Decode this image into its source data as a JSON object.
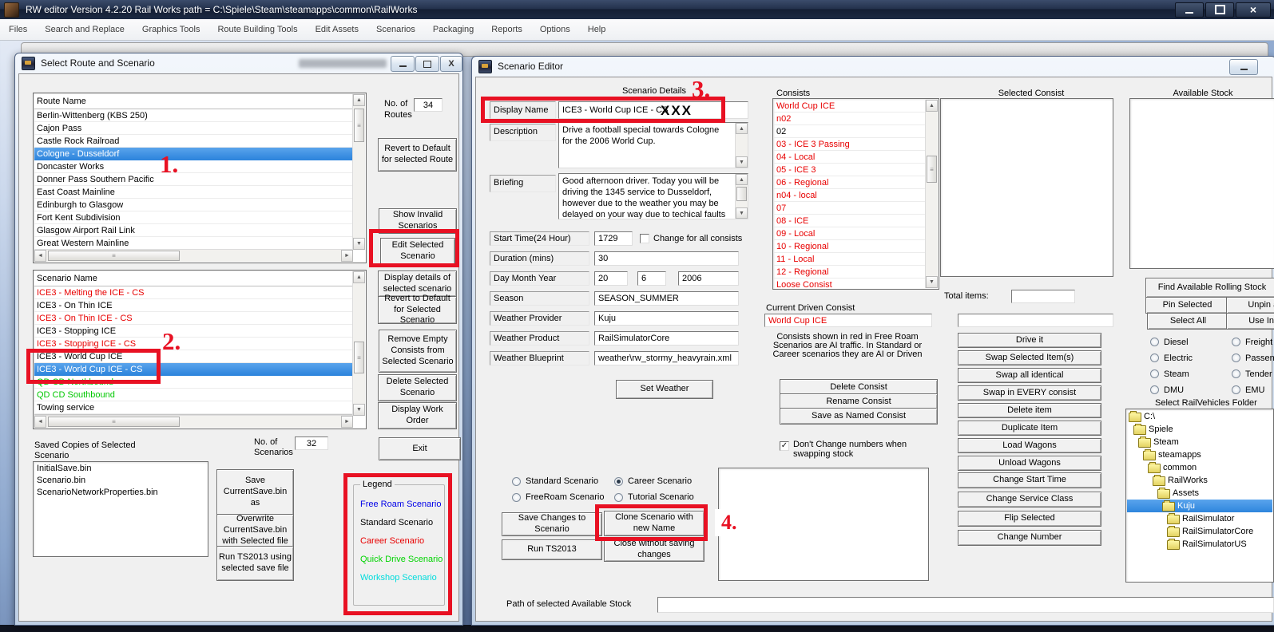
{
  "main": {
    "title": "RW editor  Version 4.2.20   Rail Works path = C:\\Spiele\\Steam\\steamapps\\common\\RailWorks",
    "menu": [
      "Files",
      "Search and Replace",
      "Graphics Tools",
      "Route Building Tools",
      "Edit Assets",
      "Scenarios",
      "Packaging",
      "Reports",
      "Options",
      "Help"
    ],
    "close_glyph": "×"
  },
  "route_window": {
    "title": "Select Route and Scenario",
    "route_header": "Route Name",
    "routes": [
      "Berlin-Wittenberg (KBS 250)",
      "Cajon Pass",
      "Castle Rock Railroad",
      {
        "label": "Cologne - Dusseldorf",
        "selected": true
      },
      "Doncaster Works",
      "Donner Pass Southern Pacific",
      "East Coast Mainline",
      "Edinburgh to Glasgow",
      "Fort Kent Subdivision",
      "Glasgow Airport Rail Link",
      "Great Western Mainline"
    ],
    "no_of_label1": "No. of",
    "no_of_routes_label2": "Routes",
    "no_of_routes_value": "34",
    "btn_revert_route": "Revert to Default for selected Route",
    "btn_show_invalid": "Show Invalid Scenarios",
    "btn_edit_selected": "Edit Selected Scenario",
    "btn_display_details": "Display details of selected scenario",
    "btn_revert_scenario": "Revert to Default for Selected Scenario",
    "btn_remove_empty": "Remove Empty Consists from Selected Scenario",
    "btn_delete_scenario": "Delete Selected Scenario",
    "btn_display_work_order": "Display Work Order",
    "btn_exit": "Exit",
    "scenario_header": "Scenario Name",
    "scenarios": [
      {
        "label": "ICE3 - Melting the ICE - CS",
        "color": "#e80000"
      },
      {
        "label": "ICE3 - On Thin ICE"
      },
      {
        "label": "ICE3 - On Thin ICE - CS",
        "color": "#e80000"
      },
      {
        "label": "ICE3 - Stopping ICE"
      },
      {
        "label": "ICE3 - Stopping ICE - CS",
        "color": "#e80000"
      },
      {
        "label": "ICE3 - World Cup ICE"
      },
      {
        "label": "ICE3 - World Cup ICE - CS",
        "selected": true
      },
      {
        "label": "QD CD Northbound",
        "color": "#00c800"
      },
      {
        "label": "QD CD Southbound",
        "color": "#00c800"
      },
      {
        "label": "Towing service"
      }
    ],
    "no_of_scenarios_label2": "Scenarios",
    "no_of_scenarios_value": "32",
    "saved_copies_label1": "Saved Copies of Selected",
    "saved_copies_label2": "Scenario",
    "saved_files": [
      "InitialSave.bin",
      "Scenario.bin",
      "ScenarioNetworkProperties.bin"
    ],
    "btn_save_current": "Save CurrentSave.bin as",
    "btn_overwrite": "Overwrite CurrentSave.bin with Selected file",
    "btn_run_ts2013_save": "Run TS2013 using selected save file",
    "legend": {
      "title": "Legend",
      "items": [
        {
          "label": "Free Roam Scenario",
          "color": "#0000e8"
        },
        {
          "label": "Standard Scenario",
          "color": "#000000"
        },
        {
          "label": "Career Scenario",
          "color": "#e80000"
        },
        {
          "label": "Quick Drive Scenario",
          "color": "#00d400"
        },
        {
          "label": "Workshop Scenario",
          "color": "#00dcdc"
        }
      ]
    }
  },
  "editor": {
    "title": "Scenario Editor",
    "details_heading": "Scenario Details",
    "display_name_label": "Display Name",
    "display_name": "ICE3 - World Cup ICE - CS",
    "description_label": "Description",
    "description": "Drive a football special towards Cologne for the 2006 World Cup.",
    "briefing_label": "Briefing",
    "briefing": "Good afternoon driver. Today you will be driving the 1345 service to Dusseldorf, however due to the weather you may be delayed on your way due to techical faults with",
    "start_time_label": "Start Time(24 Hour)",
    "start_time": "1729",
    "change_all_label": "Change for all consists",
    "duration_label": "Duration (mins)",
    "duration": "30",
    "dmy_label": "Day Month Year",
    "day": "20",
    "month": "6",
    "year": "2006",
    "season_label": "Season",
    "season": "SEASON_SUMMER",
    "weather_provider_label": "Weather Provider",
    "weather_provider": "Kuju",
    "weather_product_label": "Weather Product",
    "weather_product": "RailSimulatorCore",
    "weather_blueprint_label": "Weather Blueprint",
    "weather_blueprint": "weather\\rw_stormy_heavyrain.xml",
    "btn_set_weather": "Set Weather",
    "radio_standard": "Standard Scenario",
    "radio_freeroam": "FreeRoam Scenario",
    "radio_career": "Career Scenario",
    "radio_tutorial": "Tutorial Scenario",
    "btn_save_changes": "Save Changes to Scenario",
    "btn_clone": "Clone Scenario with new Name",
    "btn_run": "Run TS2013",
    "btn_close": "Close without saving changes",
    "path_label": "Path of selected Available Stock",
    "consists_label": "Consists",
    "consists": [
      {
        "label": "World Cup ICE",
        "color": "#e80000"
      },
      {
        "label": "n02",
        "color": "#e80000"
      },
      {
        "label": "02"
      },
      {
        "label": "03 - ICE 3 Passing",
        "color": "#e80000"
      },
      {
        "label": "04 - Local",
        "color": "#e80000"
      },
      {
        "label": "05 - ICE 3",
        "color": "#e80000"
      },
      {
        "label": "06 - Regional",
        "color": "#e80000"
      },
      {
        "label": "n04 - local",
        "color": "#e80000"
      },
      {
        "label": "07",
        "color": "#e80000"
      },
      {
        "label": "08 - ICE",
        "color": "#e80000"
      },
      {
        "label": "09 - Local",
        "color": "#e80000"
      },
      {
        "label": "10 - Regional",
        "color": "#e80000"
      },
      {
        "label": "11 - Local",
        "color": "#e80000"
      },
      {
        "label": "12 - Regional",
        "color": "#e80000"
      },
      {
        "label": "Loose Consist",
        "color": "#e80000"
      }
    ],
    "total_items_label": "Total items:",
    "current_driven_label": "Current Driven Consist",
    "current_driven": "World Cup ICE",
    "red_note": "Consists shown in red in Free Roam Scenarios are AI traffic. In Standard or Career scenarios they are AI or Driven",
    "btn_delete_consist": "Delete Consist",
    "btn_rename_consist": "Rename Consist",
    "btn_save_named": "Save as Named Consist",
    "dont_change_label1": "Don't Change numbers when",
    "dont_change_label2": "swapping stock",
    "check_glyph": "✓",
    "selected_consist_label": "Selected Consist",
    "stock_buttons": [
      "Drive it",
      "Swap Selected Item(s)",
      "Swap all identical",
      "Swap in EVERY consist",
      "Delete item",
      "Duplicate Item",
      "Load Wagons",
      "Unload Wagons"
    ],
    "change_buttons": [
      "Change Start Time",
      "Change Service Class",
      "Flip Selected",
      "Change Number"
    ],
    "available_stock_label": "Available Stock",
    "btn_find_stock": "Find Available Rolling Stock",
    "btn_pin": "Pin Selected",
    "btn_unpin": "Unpin all it",
    "btn_select_all": "Select All",
    "btn_use_index": "Use Index",
    "engine_radios_left": [
      "Diesel",
      "Electric",
      "Steam",
      "DMU"
    ],
    "engine_radios_right": [
      "Freight",
      "Passen",
      "Tender",
      "EMU"
    ],
    "select_folder_label": "Select RailVehicles Folder",
    "tree": [
      {
        "label": "C:\\",
        "indent": 0
      },
      {
        "label": "Spiele",
        "indent": 1
      },
      {
        "label": "Steam",
        "indent": 2
      },
      {
        "label": "steamapps",
        "indent": 3
      },
      {
        "label": "common",
        "indent": 4
      },
      {
        "label": "RailWorks",
        "indent": 5
      },
      {
        "label": "Assets",
        "indent": 6
      },
      {
        "label": "Kuju",
        "indent": 7,
        "selected": true
      },
      {
        "label": "RailSimulator",
        "indent": 8
      },
      {
        "label": "RailSimulatorCore",
        "indent": 8
      },
      {
        "label": "RailSimulatorUS",
        "indent": 8
      }
    ]
  },
  "annotations": {
    "n1": "1.",
    "n2": "2.",
    "n3": "3.",
    "n4": "4.",
    "xxx": "XXX"
  }
}
